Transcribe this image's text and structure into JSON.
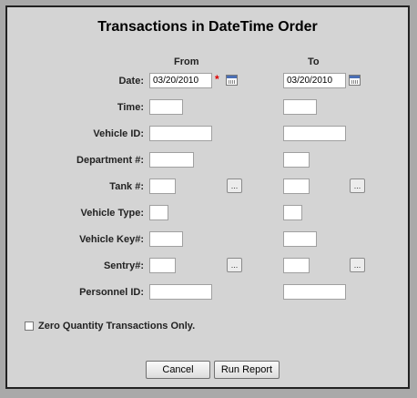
{
  "title": "Transactions in DateTime Order",
  "columns": {
    "from": "From",
    "to": "To"
  },
  "labels": {
    "date": "Date:",
    "time": "Time:",
    "vehicle_id": "Vehicle ID:",
    "department": "Department #:",
    "tank": "Tank #:",
    "vehicle_type": "Vehicle Type:",
    "vehicle_key": "Vehicle Key#:",
    "sentry": "Sentry#:",
    "personnel_id": "Personnel ID:"
  },
  "values": {
    "date_from": "03/20/2010",
    "date_to": "03/20/2010",
    "time_from": "",
    "time_to": "",
    "vehicle_id_from": "",
    "vehicle_id_to": "",
    "department_from": "",
    "department_to": "",
    "tank_from": "",
    "tank_to": "",
    "vehicle_type_from": "",
    "vehicle_type_to": "",
    "vehicle_key_from": "",
    "vehicle_key_to": "",
    "sentry_from": "",
    "sentry_to": "",
    "personnel_id_from": "",
    "personnel_id_to": ""
  },
  "required_marker": "*",
  "ellipsis_label": "...",
  "zero_quantity_label": "Zero Quantity Transactions Only.",
  "zero_quantity_checked": false,
  "buttons": {
    "cancel": "Cancel",
    "run_report": "Run Report"
  },
  "colors": {
    "required": "#e00000",
    "calendar_accent": "#4a6fb5"
  }
}
